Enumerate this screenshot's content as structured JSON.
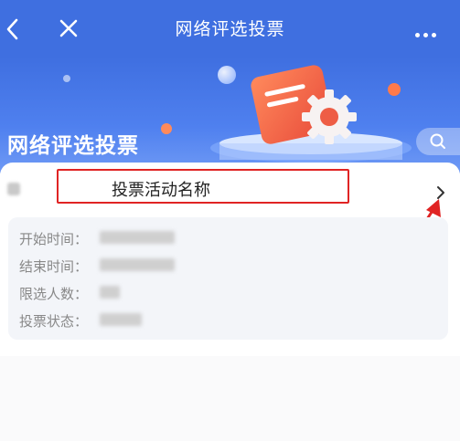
{
  "nav": {
    "title": "网络评选投票",
    "back_icon": "chevron-left-icon",
    "close_icon": "close-icon",
    "more_icon": "more-dots-icon"
  },
  "banner": {
    "title": "网络评选投票",
    "search_icon": "search-icon"
  },
  "card": {
    "vote_name": "投票活动名称",
    "chevron_icon": "chevron-right-icon",
    "fields": [
      {
        "label": "开始时间："
      },
      {
        "label": "结束时间："
      },
      {
        "label": "限选人数："
      },
      {
        "label": "投票状态："
      }
    ]
  },
  "colors": {
    "primary": "#3f6fe0",
    "highlight": "#e02424",
    "arrow": "#e02424"
  }
}
